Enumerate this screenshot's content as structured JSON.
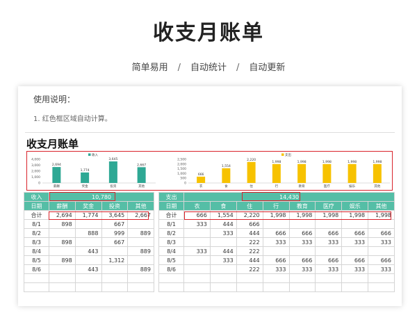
{
  "header": {
    "title": "收支月账单",
    "features": [
      "简单易用",
      "自动统计",
      "自动更新"
    ],
    "separator": "/"
  },
  "sheet": {
    "instructions_title": "使用说明：",
    "instructions": [
      "1. 红色框区域自动计算。"
    ],
    "title": "收支月账单"
  },
  "colors": {
    "teal": "#55bea6",
    "bar_income": "#2ea894",
    "bar_expense": "#f7c200",
    "red_box": "#d9222a"
  },
  "chart_data": [
    {
      "type": "bar",
      "legend": "收入",
      "legend_position": "top",
      "categories": [
        "薪酬",
        "奖金",
        "投资",
        "其他"
      ],
      "values": [
        2694,
        1774,
        3645,
        2667
      ],
      "data_labels": [
        "2,694",
        "1,774",
        "3,645",
        "2,667"
      ],
      "yticks": [
        "0",
        "1,000",
        "2,000",
        "3,000",
        "4,000"
      ],
      "ylim": [
        0,
        4000
      ]
    },
    {
      "type": "bar",
      "legend": "支出",
      "legend_position": "top",
      "categories": [
        "衣",
        "食",
        "住",
        "行",
        "教育",
        "医疗",
        "娱乐",
        "其他"
      ],
      "values": [
        666,
        1554,
        2220,
        1998,
        1998,
        1998,
        1998,
        1998
      ],
      "data_labels": [
        "666",
        "1,554",
        "2,220",
        "1,998",
        "1,998",
        "1,998",
        "1,998",
        "1,998"
      ],
      "yticks": [
        "0",
        "500",
        "1,000",
        "1,500",
        "2,000",
        "2,500"
      ],
      "ylim": [
        0,
        2500
      ]
    }
  ],
  "income": {
    "label": "收入",
    "total": "10,780",
    "date_header": "日期",
    "columns": [
      "薪酬",
      "奖金",
      "投资",
      "其他"
    ],
    "total_label": "合计",
    "totals": [
      "2,694",
      "1,774",
      "3,645",
      "2,667"
    ],
    "rows": [
      [
        "8/1",
        "898",
        "",
        "667",
        ""
      ],
      [
        "8/2",
        "",
        "888",
        "999",
        "889"
      ],
      [
        "8/3",
        "898",
        "",
        "667",
        ""
      ],
      [
        "8/4",
        "",
        "443",
        "",
        "889"
      ],
      [
        "8/5",
        "898",
        "",
        "1,312",
        ""
      ],
      [
        "8/6",
        "",
        "443",
        "",
        "889"
      ]
    ]
  },
  "expense": {
    "label": "支出",
    "total": "14,430",
    "date_header": "日期",
    "columns": [
      "衣",
      "食",
      "住",
      "行",
      "教育",
      "医疗",
      "娱乐",
      "其他"
    ],
    "total_label": "合计",
    "totals": [
      "666",
      "1,554",
      "2,220",
      "1,998",
      "1,998",
      "1,998",
      "1,998",
      "1,998"
    ],
    "rows": [
      [
        "8/1",
        "333",
        "444",
        "666",
        "",
        "",
        "",
        "",
        ""
      ],
      [
        "8/2",
        "",
        "333",
        "444",
        "666",
        "666",
        "666",
        "666",
        "666"
      ],
      [
        "8/3",
        "",
        "",
        "222",
        "333",
        "333",
        "333",
        "333",
        "333"
      ],
      [
        "8/4",
        "333",
        "444",
        "222",
        "",
        "",
        "",
        "",
        ""
      ],
      [
        "8/5",
        "",
        "333",
        "444",
        "666",
        "666",
        "666",
        "666",
        "666"
      ],
      [
        "8/6",
        "",
        "",
        "222",
        "333",
        "333",
        "333",
        "333",
        "333"
      ]
    ]
  }
}
